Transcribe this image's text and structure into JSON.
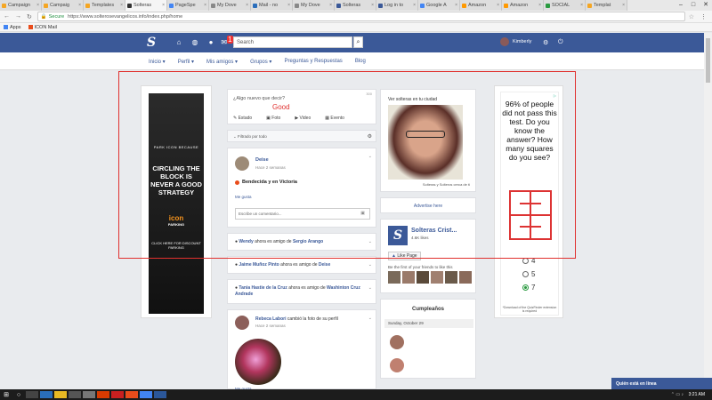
{
  "browser": {
    "tabs": [
      {
        "label": "Campaign",
        "color": "#f5a623"
      },
      {
        "label": "Campaig",
        "color": "#f5a623"
      },
      {
        "label": "Templates",
        "color": "#f5a623"
      },
      {
        "label": "Solteras",
        "color": "#333333",
        "active": true
      },
      {
        "label": "PageSpe",
        "color": "#4285f4"
      },
      {
        "label": "My Dove",
        "color": "#888888"
      },
      {
        "label": "Mail - no",
        "color": "#2a6ebb"
      },
      {
        "label": "My Dove",
        "color": "#888888"
      },
      {
        "label": "Solteras",
        "color": "#3b5998"
      },
      {
        "label": "Log in to",
        "color": "#3b5998"
      },
      {
        "label": "Google A",
        "color": "#4285f4"
      },
      {
        "label": "Amazon",
        "color": "#ff9900"
      },
      {
        "label": "Amazon",
        "color": "#ff9900"
      },
      {
        "label": "SOCIAL",
        "color": "#2a9a40"
      },
      {
        "label": "Templat",
        "color": "#f5a623"
      }
    ],
    "secure_label": "Secure",
    "url": "https://www.solterosevangelicos.info/index.php/home",
    "bookmarks": [
      "Apps",
      "ICON Mail"
    ]
  },
  "topnav": {
    "logo": "S",
    "notif_count": "1",
    "search_placeholder": "Search",
    "username": "Kimberly"
  },
  "subnav": [
    "Inicio ▾",
    "Perfil ▾",
    "Mis amigos ▾",
    "Grupos ▾",
    "Preguntas y Respuestas",
    "Blog"
  ],
  "left_ad": {
    "brand": "PARK ICON BECAUSE",
    "headline": "CIRCLING THE BLOCK IS NEVER A GOOD STRATEGY",
    "logo": "icon",
    "logo_sub": "PARKING",
    "cta": "CLICK HERE FOR DISCOUNT PARKING"
  },
  "composer": {
    "placeholder": "¿Algo nuevo que decir?",
    "counter": "300",
    "annotation": "Good",
    "actions": [
      "Estado",
      "Foto",
      "Video",
      "Evento"
    ]
  },
  "filter": {
    "label": "Filtrado por todo"
  },
  "posts": {
    "p1": {
      "name": "Deise",
      "time": "Hace 2 semanas",
      "body": "Bendecida y en Victoria",
      "like": "Me gusta",
      "comment_placeholder": "Escribe un comentario..."
    },
    "f1": {
      "user": "Wendy",
      "mid": "ahora es amigo de",
      "friend": "Sergio Arango"
    },
    "f2": {
      "user": "Jaime Muñoz Pinto",
      "mid": "ahora es amigo de",
      "friend": "Deise"
    },
    "f3": {
      "user": "Tania Hastie de la Cruz",
      "mid": "ahora es amigo de",
      "friend": "Washinton Cruz Andrade"
    },
    "p5": {
      "name": "Rebeca Labori",
      "action": "cambió la foto de su perfil",
      "time": "Hace 2 semanas",
      "like": "Me gusta"
    }
  },
  "midcol": {
    "singles_label": "Ver solteras en tu ciudad",
    "singles_caption": "Solteras y Solteros cerca de ti",
    "advertise": "Advertise here",
    "page_name": "Solteras Crist...",
    "page_likes": "4.6K likes",
    "like_page": "Like Page",
    "friends_text": "Be the first of your friends to like this",
    "birthdays_title": "Cumpleaños",
    "birthdays_date": "Sunday, October 29"
  },
  "right_ad": {
    "question": "96% of people did not pass this test. Do you know the answer? How many squares do you see?",
    "options": [
      "4",
      "5",
      "7"
    ],
    "selected": "7",
    "footer": "*Download of the QuizFinder extension is required"
  },
  "chat_label": "Quién está en línea",
  "taskbar": {
    "time": "3:21 AM"
  }
}
